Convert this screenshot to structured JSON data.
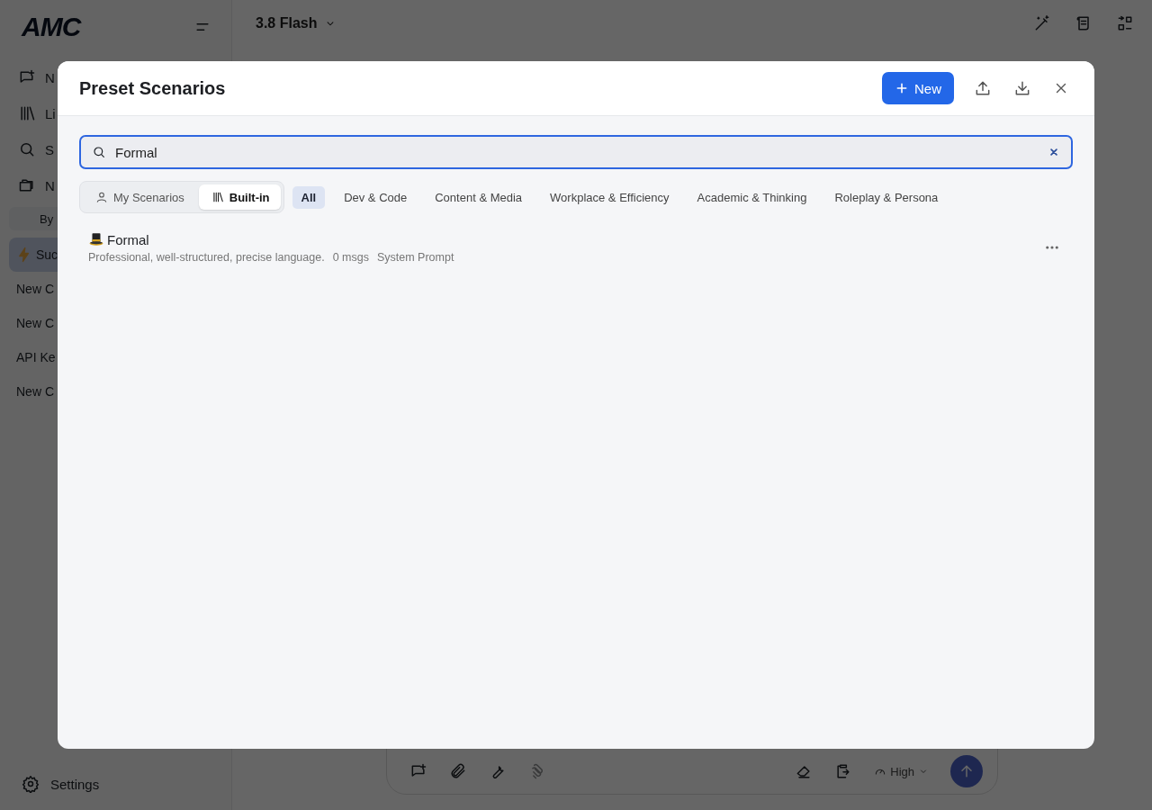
{
  "sidebar": {
    "logo": "AMC",
    "nav_items": [
      {
        "kind": "new-chat",
        "label": "N"
      },
      {
        "kind": "library",
        "label": "Li"
      },
      {
        "kind": "search",
        "label": "S"
      },
      {
        "kind": "folder",
        "label": "N"
      }
    ],
    "group_filter": "By",
    "chats": [
      {
        "title": "Suc",
        "selected": true,
        "kind": "bolt"
      },
      {
        "title": "New C",
        "selected": false
      },
      {
        "title": "New C",
        "selected": false
      },
      {
        "title": "API Ke",
        "selected": false
      },
      {
        "title": "New C",
        "selected": false
      }
    ],
    "settings": "Settings"
  },
  "header": {
    "model": "3.8 Flash"
  },
  "composer": {
    "effort": "High"
  },
  "modal": {
    "title": "Preset Scenarios",
    "new_button": "New",
    "search": {
      "value": "Formal"
    },
    "source_tabs": [
      {
        "label": "My Scenarios",
        "kind": "person",
        "selected": false
      },
      {
        "label": "Built-in",
        "kind": "library",
        "selected": true
      }
    ],
    "categories": [
      {
        "label": "All",
        "selected": true
      },
      {
        "label": "Dev & Code",
        "selected": false
      },
      {
        "label": "Content & Media",
        "selected": false
      },
      {
        "label": "Workplace & Efficiency",
        "selected": false
      },
      {
        "label": "Academic & Thinking",
        "selected": false
      },
      {
        "label": "Roleplay & Persona",
        "selected": false
      }
    ],
    "scenarios": [
      {
        "name": "Formal",
        "description": "Professional, well-structured, precise language.",
        "messages": "0 msgs",
        "type": "System Prompt"
      }
    ]
  }
}
